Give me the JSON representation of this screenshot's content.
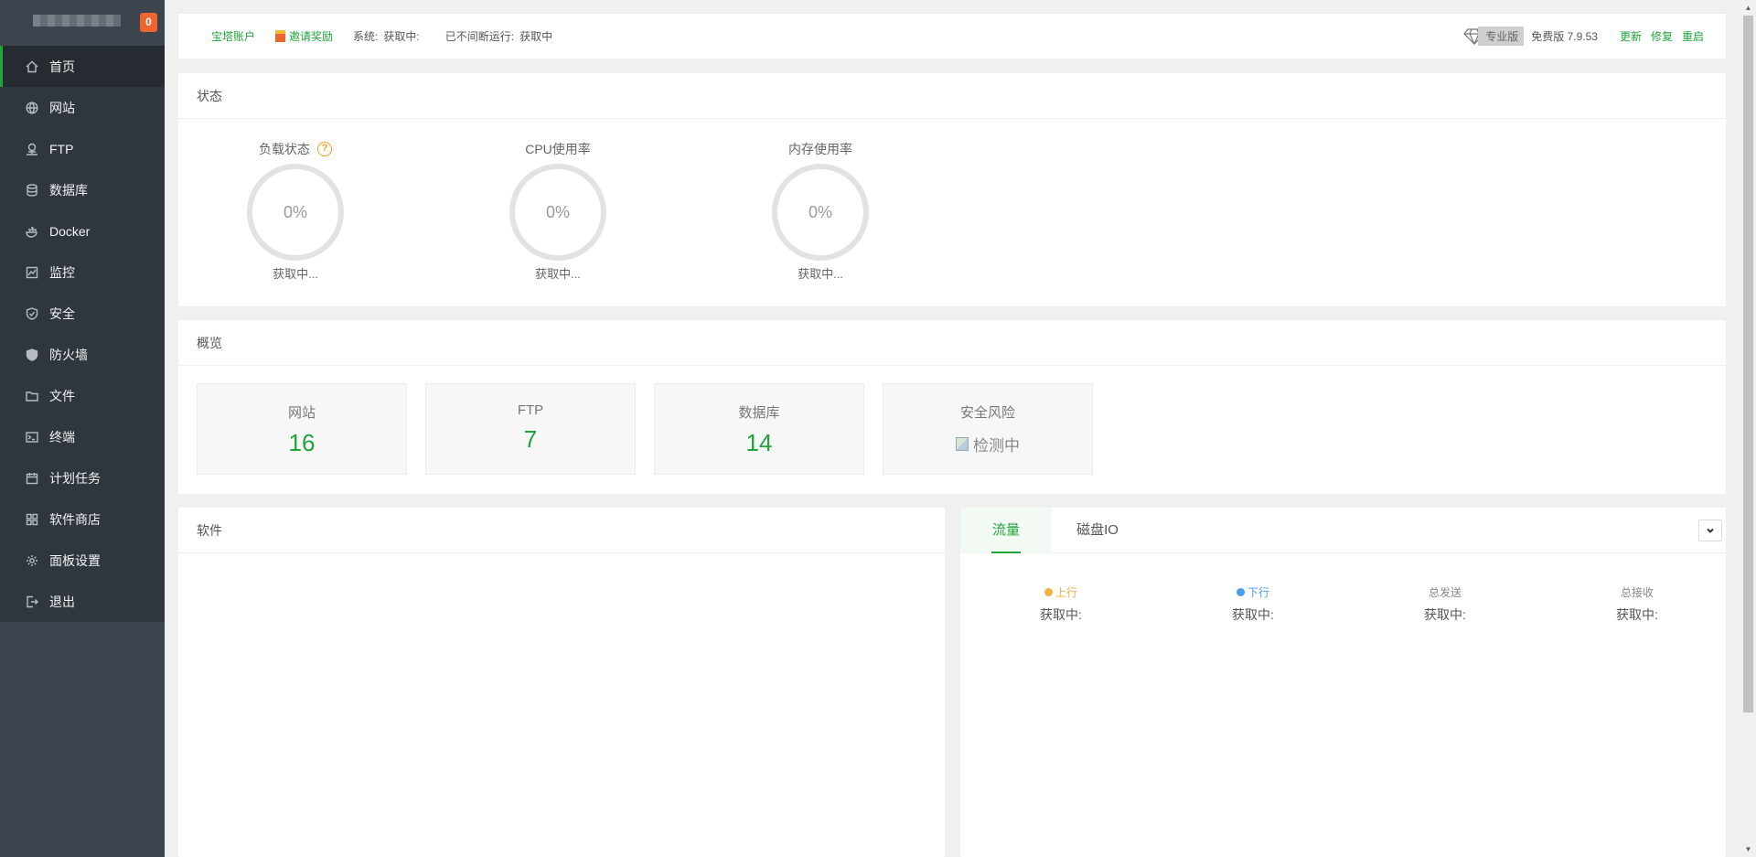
{
  "sidebar": {
    "badge_count": "0",
    "items": [
      {
        "label": "首页",
        "icon": "home-icon",
        "active": true
      },
      {
        "label": "网站",
        "icon": "globe-icon"
      },
      {
        "label": "FTP",
        "icon": "ftp-icon"
      },
      {
        "label": "数据库",
        "icon": "database-icon"
      },
      {
        "label": "Docker",
        "icon": "docker-icon"
      },
      {
        "label": "监控",
        "icon": "monitor-icon"
      },
      {
        "label": "安全",
        "icon": "shield-check-icon"
      },
      {
        "label": "防火墙",
        "icon": "firewall-shield-icon"
      },
      {
        "label": "文件",
        "icon": "folder-icon"
      },
      {
        "label": "终端",
        "icon": "terminal-icon"
      },
      {
        "label": "计划任务",
        "icon": "calendar-icon"
      },
      {
        "label": "软件商店",
        "icon": "grid-icon"
      },
      {
        "label": "面板设置",
        "icon": "gear-icon"
      },
      {
        "label": "退出",
        "icon": "logout-icon"
      }
    ]
  },
  "topbar": {
    "account_link": "宝塔账户",
    "invite_link": "邀请奖励",
    "system_label": "系统:",
    "system_value": "获取中:",
    "uptime_label": "已不间断运行:",
    "uptime_value": "获取中",
    "pro_tag": "专业版",
    "version": "免费版 7.9.53",
    "update": "更新",
    "repair": "修复",
    "restart": "重启"
  },
  "status": {
    "title": "状态",
    "gauges": [
      {
        "label": "负载状态",
        "value": "0%",
        "sub": "获取中...",
        "help": "?"
      },
      {
        "label": "CPU使用率",
        "value": "0%",
        "sub": "获取中..."
      },
      {
        "label": "内存使用率",
        "value": "0%",
        "sub": "获取中..."
      }
    ]
  },
  "overview": {
    "title": "概览",
    "cards": [
      {
        "label": "网站",
        "value": "16"
      },
      {
        "label": "FTP",
        "value": "7"
      },
      {
        "label": "数据库",
        "value": "14"
      },
      {
        "label": "安全风险",
        "value": "检测中"
      }
    ]
  },
  "software": {
    "title": "软件"
  },
  "traffic": {
    "tabs": [
      "流量",
      "磁盘IO"
    ],
    "columns": [
      {
        "label": "上行",
        "value": "获取中:",
        "dot": "#f0b040"
      },
      {
        "label": "下行",
        "value": "获取中:",
        "dot": "#4a9ef0"
      },
      {
        "label": "总发送",
        "value": "获取中:"
      },
      {
        "label": "总接收",
        "value": "获取中:"
      }
    ]
  },
  "colors": {
    "accent": "#20a53a",
    "sidebar_bg": "#3c444d",
    "badge": "#f0642d"
  }
}
